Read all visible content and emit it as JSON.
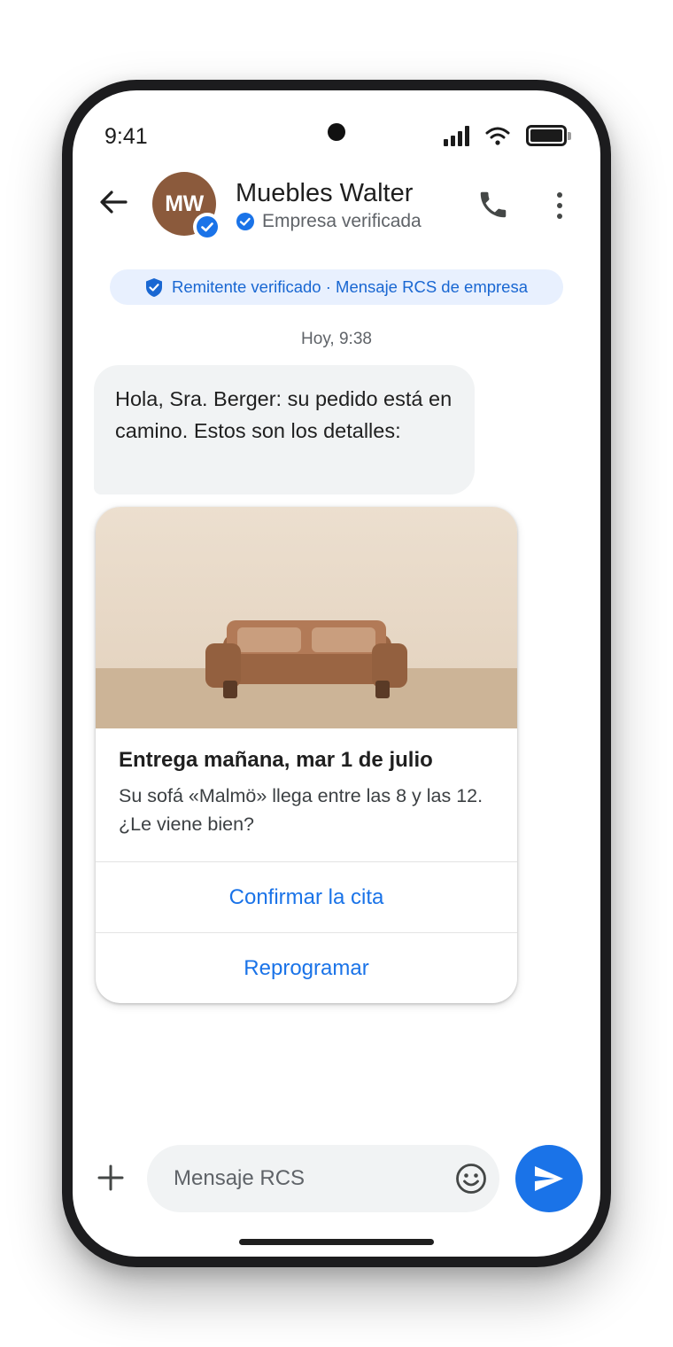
{
  "status_bar": {
    "time": "9:41"
  },
  "header": {
    "avatar_initials": "MW",
    "contact_name": "Muebles Walter",
    "verified_label": "Empresa verificada"
  },
  "banner": {
    "text": "Remitente verificado · Mensaje RCS de empresa"
  },
  "conversation": {
    "timestamp": "Hoy, 9:38",
    "message": "Hola, Sra. Berger: su pedido está en camino. Estos son los detalles:"
  },
  "rich_card": {
    "title": "Entrega mañana, mar 1 de julio",
    "description": "Su sofá «Malmö» llega entre las 8 y las 12. ¿Le viene bien?",
    "actions": [
      "Confirmar la cita",
      "Reprogramar"
    ]
  },
  "composer": {
    "placeholder": "Mensaje RCS"
  },
  "colors": {
    "accent": "#1a73e8",
    "avatar": "#8b5a3c",
    "banner_bg": "#e8f0fe",
    "bubble_bg": "#f1f3f4",
    "sofa": "#9a6543"
  },
  "icons": [
    "back-arrow-icon",
    "verified-check-icon",
    "phone-icon",
    "more-vert-icon",
    "shield-check-icon",
    "plus-icon",
    "emoji-icon",
    "send-icon",
    "signal-icon",
    "wifi-icon",
    "battery-icon"
  ]
}
